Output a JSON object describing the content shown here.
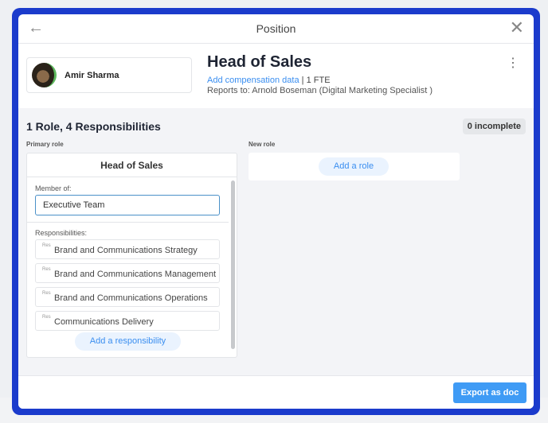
{
  "header": {
    "title": "Position"
  },
  "person": {
    "name": "Amir Sharma"
  },
  "position": {
    "title": "Head of Sales",
    "compensation_link": "Add compensation data",
    "fte": "1 FTE",
    "reports_to": "Reports to: Arnold Boseman (Digital Marketing Specialist )"
  },
  "summary": {
    "roles": "1 Role, 4 Responsibilities",
    "incomplete": "0 incomplete"
  },
  "primary_role": {
    "label": "Primary role",
    "name": "Head of Sales",
    "member_label": "Member of:",
    "member_value": "Executive Team",
    "responsibilities_label": "Responsibilities:",
    "tag": "Res",
    "responsibilities": [
      "Brand and Communications Strategy",
      "Brand and Communications Management",
      "Brand and Communications Operations",
      "Communications Delivery"
    ],
    "add_label": "Add a responsibility"
  },
  "new_role": {
    "label": "New role",
    "add_label": "Add a role"
  },
  "footer": {
    "export_label": "Export as doc"
  }
}
